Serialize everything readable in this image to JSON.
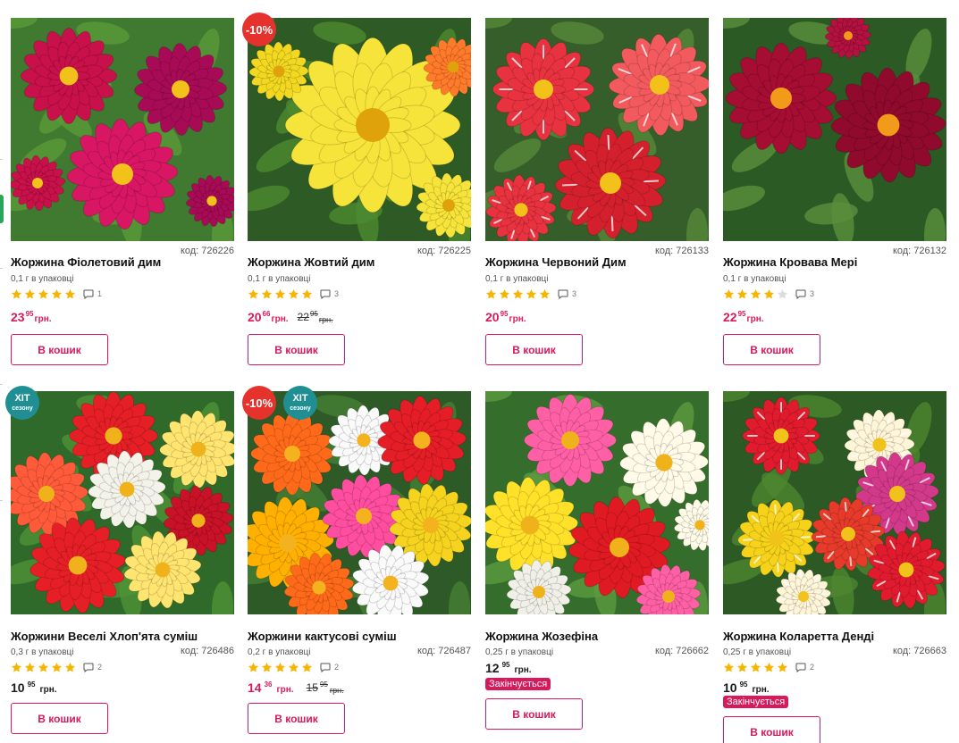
{
  "colors": {
    "accent": "#d8195b",
    "sale_badge": "#e5322d",
    "hit_badge": "#1f8f93",
    "star": "#f6b500"
  },
  "products": [
    {
      "title": "Жоржина Фіолетовий дим",
      "code": "код: 726226",
      "pack": "0,1 г в упаковці",
      "stars": 5,
      "reviews": "1",
      "price_int": "23",
      "price_dec": "95",
      "currency": "грн.",
      "button": "В кошик"
    },
    {
      "title": "Жоржина Жовтий дим",
      "code": "код: 726225",
      "pack": "0,1 г в упаковці",
      "stars": 5,
      "reviews": "3",
      "badge": "-10%",
      "price_int": "20",
      "price_dec": "66",
      "currency": "грн.",
      "old_int": "22",
      "old_dec": "95",
      "old_currency": "грн.",
      "button": "В кошик"
    },
    {
      "title": "Жоржина Червоний Дим",
      "code": "код: 726133",
      "pack": "0,1 г в упаковці",
      "stars": 5,
      "reviews": "3",
      "price_int": "20",
      "price_dec": "95",
      "currency": "грн.",
      "button": "В кошик"
    },
    {
      "title": "Жоржина Кровава Мері",
      "code": "код: 726132",
      "pack": "0,1 г в упаковці",
      "stars": 4,
      "reviews": "3",
      "price_int": "22",
      "price_dec": "95",
      "currency": "грн.",
      "button": "В кошик"
    },
    {
      "title": "Жоржини Веселі Хлоп'ята суміш",
      "code": "код: 726486",
      "pack": "0,3 г в упаковці",
      "stars": 5,
      "reviews": "2",
      "hit_line1": "ХІТ",
      "hit_line2": "сезону",
      "price_int": "10",
      "price_dec": "95",
      "currency": "грн.",
      "button": "В кошик"
    },
    {
      "title": "Жоржини кактусові суміш",
      "code": "код: 726487",
      "pack": "0,2 г в упаковці",
      "stars": 5,
      "reviews": "2",
      "badge": "-10%",
      "hit_line1": "ХІТ",
      "hit_line2": "сезону",
      "price_int": "14",
      "price_dec": "36",
      "currency": "грн.",
      "old_int": "15",
      "old_dec": "95",
      "old_currency": "грн.",
      "button": "В кошик"
    },
    {
      "title": "Жоржина Жозефіна",
      "code": "код: 726662",
      "pack": "0,25 г в упаковці",
      "price_int": "12",
      "price_dec": "95",
      "currency": "грн.",
      "status": "Закінчується",
      "button": "В кошик"
    },
    {
      "title": "Жоржина Коларетта Денді",
      "code": "код: 726663",
      "pack": "0,25 г в упаковці",
      "stars": 5,
      "reviews": "2",
      "price_int": "10",
      "price_dec": "95",
      "currency": "грн.",
      "status": "Закінчується",
      "button": "В кошик"
    }
  ]
}
